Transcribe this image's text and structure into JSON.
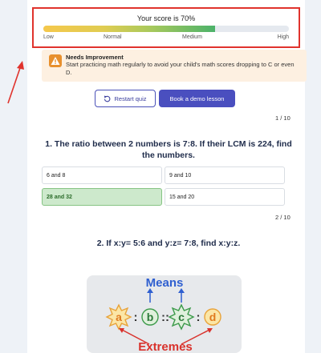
{
  "score": {
    "title": "Your score is 70%",
    "percent": 70,
    "labels": [
      "Low",
      "Normal",
      "Medium",
      "High"
    ]
  },
  "alert": {
    "title": "Needs Improvement",
    "message": "Start practicing math regularly to avoid your child's math scores dropping to C or even D."
  },
  "actions": {
    "restart_label": "Restart quiz",
    "demo_label": "Book a demo lesson"
  },
  "questions": [
    {
      "counter": "1 / 10",
      "text": "1. The ratio between 2 numbers is 7:8. If their LCM is 224, find the numbers.",
      "options": [
        "6 and 8",
        "9 and 10",
        "28 and 32",
        "15 and 20"
      ],
      "selected_index": 2
    },
    {
      "counter": "2 / 10",
      "text": "2. If x:y= 5:6 and y:z= 7:8, find x:y:z.",
      "figure": {
        "top_label": "Means",
        "bottom_label": "Extremes",
        "terms": [
          "a",
          "b",
          "c",
          "d"
        ],
        "separators": [
          ":",
          "::",
          ":"
        ]
      }
    }
  ],
  "colors": {
    "highlight_border": "#e0332d",
    "primary": "#4a4fbf",
    "correct_fill": "#cde9cc",
    "warning_fill": "#fdf0e1",
    "means_color": "#2f5fd0",
    "extremes_color": "#d9322c"
  }
}
